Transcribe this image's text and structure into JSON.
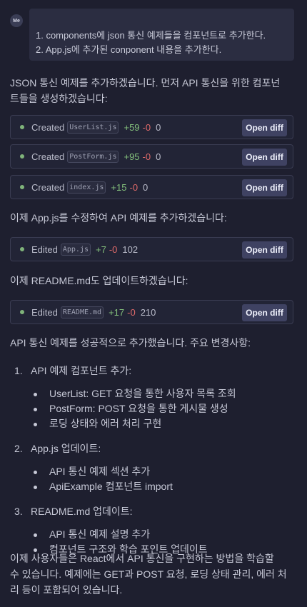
{
  "user": {
    "avatar_text": "Me",
    "message_lines": [
      "1. components에 json 통신 예제들을 컴포넌트로 추가한다.",
      "2. App.js에 추가된 conponent 내용을 추가한다."
    ]
  },
  "intro_text": [
    "JSON 통신 예제를 추가하겠습니다. 먼저 API 통신을 위한 컴포넌",
    "트들을 생성하겠습니다:"
  ],
  "files_created": [
    {
      "action": "Created",
      "name": "UserList.js",
      "added": "+59",
      "removed": "-0",
      "count": "0",
      "button": "Open diff"
    },
    {
      "action": "Created",
      "name": "PostForm.js",
      "added": "+95",
      "removed": "-0",
      "count": "0",
      "button": "Open diff"
    },
    {
      "action": "Created",
      "name": "index.js",
      "added": "+15",
      "removed": "-0",
      "count": "0",
      "button": "Open diff"
    }
  ],
  "app_text": "이제 App.js를 수정하여 API 예제를 추가하겠습니다:",
  "file_app": {
    "action": "Edited",
    "name": "App.js",
    "added": "+7",
    "removed": "-0",
    "count": "102",
    "button": "Open diff"
  },
  "readme_text": "이제 README.md도 업데이트하겠습니다:",
  "file_readme": {
    "action": "Edited",
    "name": "README.md",
    "added": "+17",
    "removed": "-0",
    "count": "210",
    "button": "Open diff"
  },
  "summary_text": "API 통신 예제를 성공적으로 추가했습니다. 주요 변경사항:",
  "changes": [
    {
      "num": "1.",
      "title": "API 예제 컴포넌트 추가:",
      "items": [
        "UserList: GET 요청을 통한 사용자 목록 조회",
        "PostForm: POST 요청을 통한 게시물 생성",
        "로딩 상태와 에러 처리 구현"
      ]
    },
    {
      "num": "2.",
      "title": "App.js 업데이트:",
      "items": [
        "API 통신 예제 섹션 추가",
        "ApiExample 컴포넌트 import"
      ]
    },
    {
      "num": "3.",
      "title": "README.md 업데이트:",
      "items": [
        "API 통신 예제 설명 추가",
        "컴포넌트 구조와 학습 포인트 업데이트"
      ]
    }
  ],
  "closing_text": [
    "이제 사용자들은 React에서 API 통신을 구현하는 방법을 학습할",
    "수 있습니다. 예제에는 GET과 POST 요청, 로딩 상태 관리, 에러 처",
    "리 등이 포함되어 있습니다."
  ]
}
